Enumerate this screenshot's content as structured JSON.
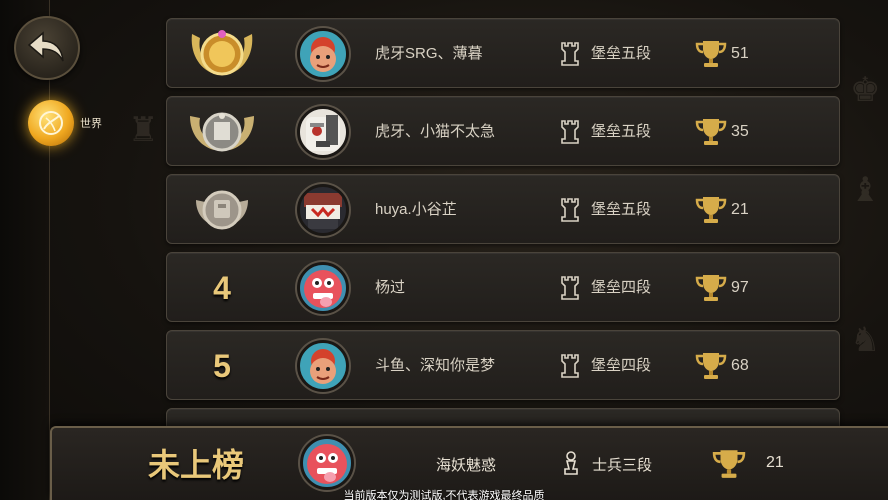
{
  "sidebar": {
    "back_icon": "back-arrow-icon",
    "tabs": [
      {
        "label": "世界",
        "icon": "globe-icon",
        "active": true
      }
    ]
  },
  "leaderboard": {
    "rows": [
      {
        "rank": "1",
        "rank_display": "gold-winged-medal",
        "avatar": "orange-hair-hero",
        "name": "虎牙SRG、薄暮",
        "tier": "堡垒五段",
        "trophies": "51"
      },
      {
        "rank": "2",
        "rank_display": "silver-winged-medal",
        "avatar": "skull-hood",
        "name": "虎牙、小猫不太急",
        "tier": "堡垒五段",
        "trophies": "35"
      },
      {
        "rank": "3",
        "rank_display": "bronze-medal",
        "avatar": "ninja-mask",
        "name": "huya.小谷芷",
        "tier": "堡垒五段",
        "trophies": "21"
      },
      {
        "rank": "4",
        "rank_display": "number",
        "avatar": "pink-monster",
        "name": "杨过",
        "tier": "堡垒四段",
        "trophies": "97"
      },
      {
        "rank": "5",
        "rank_display": "number",
        "avatar": "orange-hair-hero",
        "name": "斗鱼、深知你是梦",
        "tier": "堡垒四段",
        "trophies": "68"
      }
    ]
  },
  "my_rank": {
    "rank_label": "未上榜",
    "avatar": "pink-monster",
    "name": "海妖魅惑",
    "tier": "士兵三段",
    "trophies": "21"
  },
  "footer": {
    "note": "当前版本仅为测试版,不代表游戏最终品质"
  },
  "colors": {
    "gold": "#e9c87a",
    "panel": "#2b2824",
    "accent_glow": "#f0a820"
  }
}
